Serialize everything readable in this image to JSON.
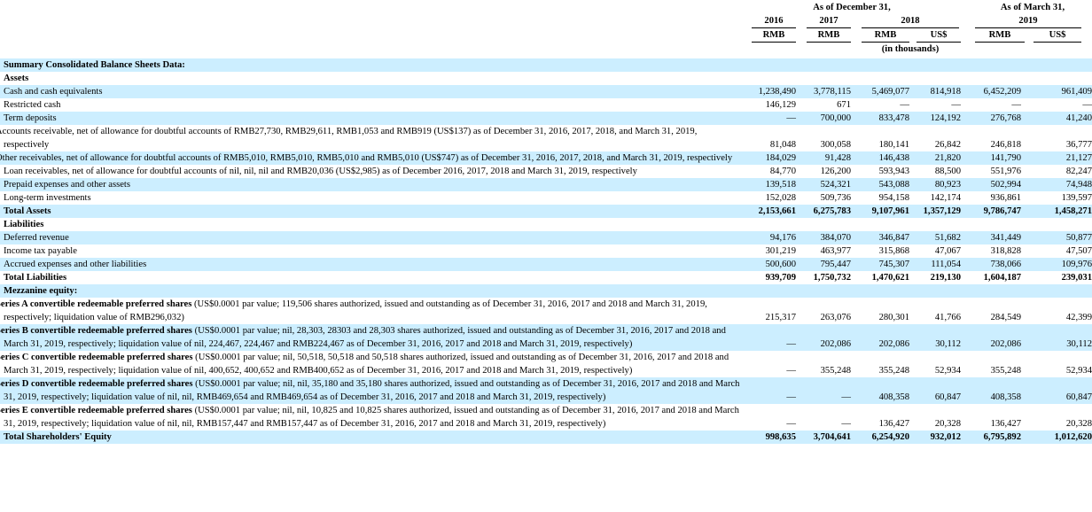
{
  "header": {
    "as_of_december": "As of December 31,",
    "as_of_march": "As of March 31,",
    "years": [
      "2016",
      "2017",
      "2018",
      "2019"
    ],
    "currencies": [
      "RMB",
      "RMB",
      "RMB",
      "US$",
      "RMB",
      "US$"
    ],
    "in_thousands": "(in thousands)"
  },
  "rows": [
    {
      "label": "Summary Consolidated Balance Sheets Data:",
      "kind": "section",
      "shade": true
    },
    {
      "label": "Assets",
      "kind": "section",
      "shade": false
    },
    {
      "label": "Cash and cash equivalents",
      "kind": "item",
      "shade": true,
      "values": [
        "1,238,490",
        "3,778,115",
        "5,469,077",
        "814,918",
        "6,452,209",
        "961,409"
      ]
    },
    {
      "label": "Restricted cash",
      "kind": "item",
      "shade": false,
      "values": [
        "146,129",
        "671",
        "—",
        "—",
        "—",
        "—"
      ]
    },
    {
      "label": "Term deposits",
      "kind": "item",
      "shade": true,
      "values": [
        "—",
        "700,000",
        "833,478",
        "124,192",
        "276,768",
        "41,240"
      ]
    },
    {
      "label": "Accounts receivable, net of allowance for doubtful accounts of RMB27,730, RMB29,611, RMB1,053 and RMB919 (US$137) as of December 31, 2016, 2017, 2018, and March 31, 2019, respectively",
      "kind": "item-wrap",
      "shade": false,
      "values": [
        "81,048",
        "300,058",
        "180,141",
        "26,842",
        "246,818",
        "36,777"
      ]
    },
    {
      "label": "Other receivables, net of allowance for doubtful accounts of RMB5,010, RMB5,010, RMB5,010 and RMB5,010 (US$747) as of December 31, 2016, 2017, 2018, and March 31, 2019, respectively",
      "kind": "item-wrap",
      "shade": true,
      "values": [
        "184,029",
        "91,428",
        "146,438",
        "21,820",
        "141,790",
        "21,127"
      ]
    },
    {
      "label": "Loan receivables, net of allowance for doubtful accounts of nil, nil, nil and RMB20,036 (US$2,985) as of December 2016, 2017, 2018 and March 31, 2019, respectively",
      "kind": "item",
      "shade": false,
      "values": [
        "84,770",
        "126,200",
        "593,943",
        "88,500",
        "551,976",
        "82,247"
      ]
    },
    {
      "label": "Prepaid expenses and other assets",
      "kind": "item",
      "shade": true,
      "values": [
        "139,518",
        "524,321",
        "543,088",
        "80,923",
        "502,994",
        "74,948"
      ]
    },
    {
      "label": "Long-term investments",
      "kind": "item",
      "shade": false,
      "values": [
        "152,028",
        "509,736",
        "954,158",
        "142,174",
        "936,861",
        "139,597"
      ]
    },
    {
      "label": "Total Assets",
      "kind": "total",
      "shade": true,
      "values": [
        "2,153,661",
        "6,275,783",
        "9,107,961",
        "1,357,129",
        "9,786,747",
        "1,458,271"
      ]
    },
    {
      "label": "Liabilities",
      "kind": "section",
      "shade": false
    },
    {
      "label": "Deferred revenue",
      "kind": "item",
      "shade": true,
      "values": [
        "94,176",
        "384,070",
        "346,847",
        "51,682",
        "341,449",
        "50,877"
      ]
    },
    {
      "label": "Income tax payable",
      "kind": "item",
      "shade": false,
      "values": [
        "301,219",
        "463,977",
        "315,868",
        "47,067",
        "318,828",
        "47,507"
      ]
    },
    {
      "label": "Accrued expenses and other liabilities",
      "kind": "item",
      "shade": true,
      "values": [
        "500,600",
        "795,447",
        "745,307",
        "111,054",
        "738,066",
        "109,976"
      ]
    },
    {
      "label": "Total Liabilities",
      "kind": "total",
      "shade": false,
      "values": [
        "939,709",
        "1,750,732",
        "1,470,621",
        "219,130",
        "1,604,187",
        "239,031"
      ]
    },
    {
      "label": "Mezzanine equity:",
      "kind": "section",
      "shade": true
    },
    {
      "bold": "Series A convertible redeemable preferred shares",
      "label": " (US$0.0001 par value; 119,506 shares authorized, issued and outstanding as of December 31, 2016, 2017 and 2018 and March 31, 2019, respectively; liquidation value of RMB296,032)",
      "kind": "series",
      "shade": false,
      "values": [
        "215,317",
        "263,076",
        "280,301",
        "41,766",
        "284,549",
        "42,399"
      ]
    },
    {
      "bold": "Series B convertible redeemable preferred shares",
      "label": " (US$0.0001 par value; nil, 28,303, 28303 and 28,303 shares authorized, issued and outstanding as of December 31, 2016, 2017 and 2018 and March 31, 2019, respectively; liquidation value of nil, 224,467, 224,467 and RMB224,467 as of December 31, 2016, 2017 and 2018 and March 31, 2019, respectively)",
      "kind": "series",
      "shade": true,
      "values": [
        "—",
        "202,086",
        "202,086",
        "30,112",
        "202,086",
        "30,112"
      ]
    },
    {
      "bold": "Series C convertible redeemable preferred shares",
      "label": " (US$0.0001 par value; nil, 50,518, 50,518 and 50,518 shares authorized, issued and outstanding as of December 31, 2016, 2017 and 2018 and March 31, 2019, respectively; liquidation value of nil, 400,652, 400,652 and RMB400,652 as of December 31, 2016, 2017 and 2018 and March 31, 2019, respectively)",
      "kind": "series",
      "shade": false,
      "values": [
        "—",
        "355,248",
        "355,248",
        "52,934",
        "355,248",
        "52,934"
      ]
    },
    {
      "bold": "Series D convertible redeemable preferred shares",
      "label": " (US$0.0001 par value; nil, nil, 35,180 and 35,180 shares authorized, issued and outstanding as of December 31, 2016, 2017 and 2018 and March 31, 2019, respectively; liquidation value of nil, nil, RMB469,654 and RMB469,654 as of December 31, 2016, 2017 and 2018 and March 31, 2019, respectively)",
      "kind": "series",
      "shade": true,
      "values": [
        "—",
        "—",
        "408,358",
        "60,847",
        "408,358",
        "60,847"
      ]
    },
    {
      "bold": "Series E convertible redeemable preferred shares",
      "label": " (US$0.0001 par value; nil, nil, 10,825 and 10,825 shares authorized, issued and outstanding as of December 31, 2016, 2017 and 2018 and March 31, 2019, respectively; liquidation value of nil, nil, RMB157,447 and RMB157,447 as of December 31, 2016, 2017 and 2018 and March 31, 2019, respectively)",
      "kind": "series",
      "shade": false,
      "values": [
        "—",
        "—",
        "136,427",
        "20,328",
        "136,427",
        "20,328"
      ]
    },
    {
      "label": "Total Shareholders' Equity",
      "kind": "total",
      "shade": true,
      "values": [
        "998,635",
        "3,704,641",
        "6,254,920",
        "932,012",
        "6,795,892",
        "1,012,620"
      ]
    }
  ]
}
